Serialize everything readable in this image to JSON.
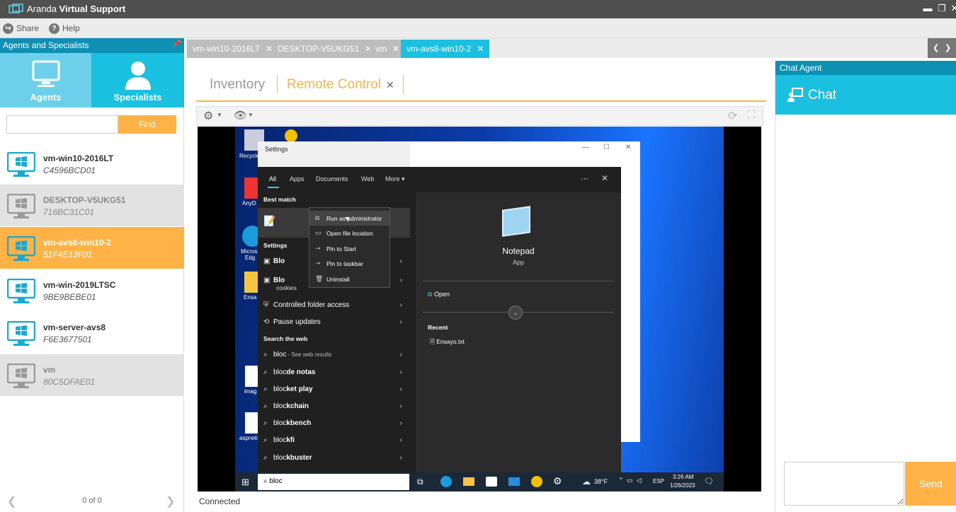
{
  "app": {
    "title_brand": "Aranda",
    "title_product": "Virtual Support"
  },
  "window_controls": {
    "minimize": "▬",
    "restore": "❐",
    "close": "✕"
  },
  "menu": {
    "share": "Share",
    "help": "Help"
  },
  "left_panel": {
    "header": "Agents and Specialists",
    "tabs": {
      "agents": "Agents",
      "specialists": "Specialists"
    },
    "find_button": "Find",
    "find_placeholder": "",
    "agents": [
      {
        "name": "vm-win10-2016LT",
        "id": "C4596BCD01",
        "state": "online"
      },
      {
        "name": "DESKTOP-V5UKG51",
        "id": "716BC31C01",
        "state": "offline"
      },
      {
        "name": "vm-avs8-win10-2",
        "id": "51F4E13F01",
        "state": "selected"
      },
      {
        "name": "vm-win-2019LTSC",
        "id": "9BE9BEBE01",
        "state": "online"
      },
      {
        "name": "vm-server-avs8",
        "id": "F6E3677501",
        "state": "online"
      },
      {
        "name": "vm",
        "id": "80C5DFAE01",
        "state": "offline"
      }
    ],
    "pager": {
      "info": "0 of 0"
    }
  },
  "session_tabs": [
    {
      "label": "vm-win10-2016LT",
      "active": false
    },
    {
      "label": "DESKTOP-V5UKG51",
      "active": false
    },
    {
      "label": "vm",
      "active": false
    },
    {
      "label": "vm-avs8-win10-2",
      "active": true
    }
  ],
  "main": {
    "subtabs": {
      "inventory": "Inventory",
      "remote_control": "Remote Control"
    },
    "status": "Connected"
  },
  "remote": {
    "desktop_labels": {
      "recycle": "Recycle",
      "anydesk": "AnyD",
      "edge1": "Micros",
      "edge2": "Edg",
      "ensayo": "Ensa",
      "image": "imag",
      "aspnet": "aspneti"
    },
    "settings_title": "Settings",
    "search": {
      "tabs": [
        "All",
        "Apps",
        "Documents",
        "Web",
        "More"
      ],
      "best_match": "Best match",
      "settings_section": "Settings",
      "settings_items": [
        {
          "bold": "Blo",
          "rest": ""
        },
        {
          "bold": "Blo",
          "rest": "cookies"
        },
        {
          "bold": "",
          "rest": "Controlled folder access"
        },
        {
          "bold": "",
          "rest": "Pause updates"
        }
      ],
      "web_section": "Search the web",
      "web_items": [
        {
          "base": "bloc",
          "rest": "",
          "sub": " - See web results"
        },
        {
          "base": "bloc",
          "rest": " de notas",
          "sub": ""
        },
        {
          "base": "bloc",
          "rest": "ket play",
          "sub": ""
        },
        {
          "base": "bloc",
          "rest": "kchain",
          "sub": ""
        },
        {
          "base": "bloc",
          "rest": "kbench",
          "sub": ""
        },
        {
          "base": "bloc",
          "rest": "kfi",
          "sub": ""
        },
        {
          "base": "bloc",
          "rest": "kbuster",
          "sub": ""
        }
      ],
      "app_name": "Notepad",
      "app_type": "App",
      "open": "Open",
      "recent": "Recent",
      "recent_file": "Ensayo.txt",
      "query": "bloc"
    },
    "context_menu": [
      "Run as administrator",
      "Open file location",
      "Pin to Start",
      "Pin to taskbar",
      "Uninstall"
    ],
    "taskbar": {
      "weather": "38°F",
      "lang": "ESP",
      "time": "3:26 AM",
      "date": "1/26/2023"
    }
  },
  "chat": {
    "header": "Chat Agent",
    "title": "Chat",
    "send": "Send"
  },
  "colors": {
    "accent_blue": "#1bbfe0",
    "header_blue": "#0e8fb4",
    "accent_orange": "#ffb347",
    "subtab_orange": "#f2b64a"
  }
}
